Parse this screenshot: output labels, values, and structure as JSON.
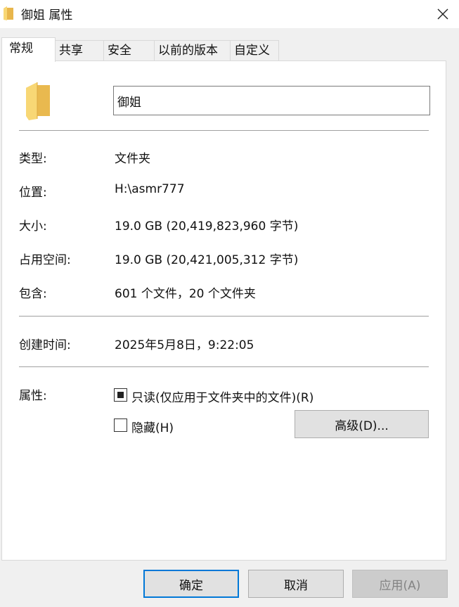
{
  "window": {
    "title": "御姐 属性",
    "title_icon": "folder-icon",
    "close_icon": "close-icon"
  },
  "tabs": [
    {
      "label": "常规",
      "active": true
    },
    {
      "label": "共享"
    },
    {
      "label": "安全"
    },
    {
      "label": "以前的版本"
    },
    {
      "label": "自定义"
    }
  ],
  "general": {
    "folder_icon": "folder-icon",
    "name_value": "御姐",
    "fields": {
      "type_label": "类型:",
      "type_value": "文件夹",
      "location_label": "位置:",
      "location_value": "H:\\asmr777",
      "size_label": "大小:",
      "size_value": "19.0 GB (20,419,823,960 字节)",
      "size_on_disk_label": "占用空间:",
      "size_on_disk_value": "19.0 GB (20,421,005,312 字节)",
      "contains_label": "包含:",
      "contains_value": "601 个文件，20 个文件夹",
      "created_label": "创建时间:",
      "created_value": "2025年5月8日，9:22:05"
    },
    "attributes": {
      "label": "属性:",
      "readonly_label": "只读(仅应用于文件夹中的文件)(R)",
      "readonly_state": "indeterminate",
      "hidden_label": "隐藏(H)",
      "hidden_checked": false,
      "advanced_label": "高级(D)..."
    }
  },
  "buttons": {
    "ok": "确定",
    "cancel": "取消",
    "apply": "应用(A)",
    "apply_disabled": true
  },
  "colors": {
    "accent": "#0078d7",
    "folder": "#f8d775"
  }
}
